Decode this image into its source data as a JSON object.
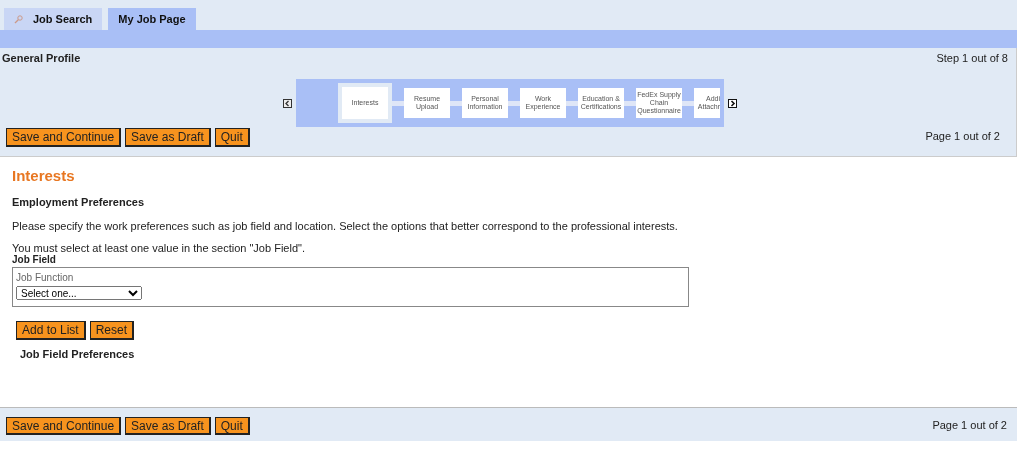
{
  "tabs": [
    {
      "label": "Job Search",
      "selected": false,
      "icon": true
    },
    {
      "label": "My Job Page",
      "selected": true,
      "icon": false
    }
  ],
  "header": {
    "title": "General Profile",
    "step": "Step 1 out of 8",
    "page": "Page 1 out of 2"
  },
  "steps": [
    {
      "lines": [
        "Interests"
      ],
      "selected": true
    },
    {
      "lines": [
        "Resume",
        "Upload"
      ],
      "selected": false
    },
    {
      "lines": [
        "Personal",
        "Information"
      ],
      "selected": false
    },
    {
      "lines": [
        "Work",
        "Experience"
      ],
      "selected": false
    },
    {
      "lines": [
        "Education &",
        "Certifications"
      ],
      "selected": false
    },
    {
      "lines": [
        "FedEx Supply",
        "Chain",
        "Questionnaire"
      ],
      "selected": false
    },
    {
      "lines": [
        "Addi",
        "Attachr"
      ],
      "selected": false,
      "cut": true
    }
  ],
  "actions": [
    "Save and Continue",
    "Save as Draft",
    "Quit"
  ],
  "content": {
    "title": "Interests",
    "section": "Employment Preferences",
    "intro": "Please specify the work preferences such as job field and location. Select the options that better correspond to the professional interests.",
    "notice": "You must select at least one value in the section \"Job Field\".",
    "field_group": "Job Field",
    "field_label": "Job Function",
    "field_value": "Select one...",
    "list_buttons": [
      "Add to List",
      "Reset"
    ],
    "list_title": "Job Field Preferences"
  },
  "footer": {
    "actions": [
      "Save and Continue",
      "Save as Draft",
      "Quit"
    ],
    "page": "Page 1 out of 2"
  }
}
